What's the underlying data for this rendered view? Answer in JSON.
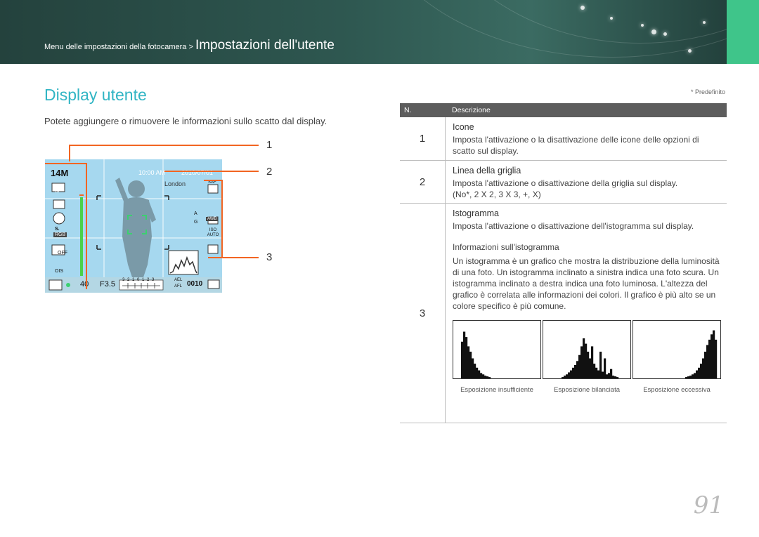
{
  "header": {
    "breadcrumb_small": "Menu delle impostazioni della fotocamera > ",
    "breadcrumb_big": "Impostazioni dell'utente"
  },
  "page": {
    "title": "Display utente",
    "intro": "Potete aggiungere o rimuovere le informazioni sullo scatto dal display.",
    "default_note": "* Predefinito",
    "page_number": "91"
  },
  "callouts": [
    "1",
    "2",
    "3"
  ],
  "screen": {
    "resolution": "14M",
    "time": "10:00 AM",
    "date": "2010/07/01",
    "city": "London",
    "shutter": "40",
    "aperture": "F3.5",
    "scale": "3 2 1 0 1 2 3",
    "ael": "AEL",
    "afl": "AFL",
    "shots": "0010",
    "awb": "AWB",
    "iso": "ISO AUTO",
    "ois": "OIS",
    "rgb": "RGB",
    "off": "OFF",
    "sf": "SF",
    "s": "S.",
    "a": "A",
    "g": "G",
    "saf": "SAF"
  },
  "table": {
    "col_n": "N.",
    "col_desc": "Descrizione",
    "rows": [
      {
        "num": "1",
        "head": "Icone",
        "text": "Imposta l'attivazione o la disattivazione delle icone delle opzioni di scatto sul display."
      },
      {
        "num": "2",
        "head": "Linea della griglia",
        "text": "Imposta l'attivazione o disattivazione della griglia sul display.",
        "options": "(No*, 2 X 2, 3 X 3, +, X)"
      },
      {
        "num": "3",
        "head": "Istogramma",
        "text": "Imposta l'attivazione o disattivazione dell'istogramma sul display.",
        "subhead": "Informazioni sull'istogramma",
        "subtext": "Un istogramma è un grafico che mostra la distribuzione della luminosità di una foto. Un istogramma inclinato a sinistra indica una foto scura. Un istogramma inclinato a destra indica una foto luminosa. L'altezza del grafico è correlata alle informazioni dei colori. Il grafico è più alto se un colore specifico è più comune.",
        "histograms": [
          {
            "caption": "Esposizione insufficiente",
            "bars": [
              0,
              0,
              0,
              55,
              70,
              62,
              48,
              40,
              30,
              22,
              16,
              12,
              8,
              6,
              4,
              3,
              2,
              0,
              0,
              0,
              0,
              0,
              0,
              0,
              0,
              0,
              0,
              0,
              0,
              0,
              0,
              0,
              0,
              0,
              0,
              0,
              0,
              0,
              0,
              0
            ]
          },
          {
            "caption": "Esposizione bilanciata",
            "bars": [
              0,
              0,
              0,
              0,
              0,
              0,
              0,
              0,
              2,
              4,
              6,
              9,
              12,
              16,
              20,
              26,
              35,
              48,
              60,
              52,
              40,
              30,
              48,
              22,
              16,
              12,
              40,
              10,
              30,
              6,
              8,
              14,
              4,
              3,
              2,
              0,
              0,
              0,
              0,
              0
            ]
          },
          {
            "caption": "Esposizione eccessiva",
            "bars": [
              0,
              0,
              0,
              0,
              0,
              0,
              0,
              0,
              0,
              0,
              0,
              0,
              0,
              0,
              0,
              0,
              0,
              0,
              0,
              0,
              0,
              0,
              0,
              0,
              2,
              3,
              4,
              6,
              8,
              12,
              16,
              22,
              30,
              40,
              50,
              58,
              66,
              72,
              58,
              0
            ]
          }
        ]
      }
    ]
  },
  "colors": {
    "accent": "#31b5c4",
    "callout": "#f26522",
    "banner": "#2e5750",
    "tab": "#3fc58a"
  }
}
